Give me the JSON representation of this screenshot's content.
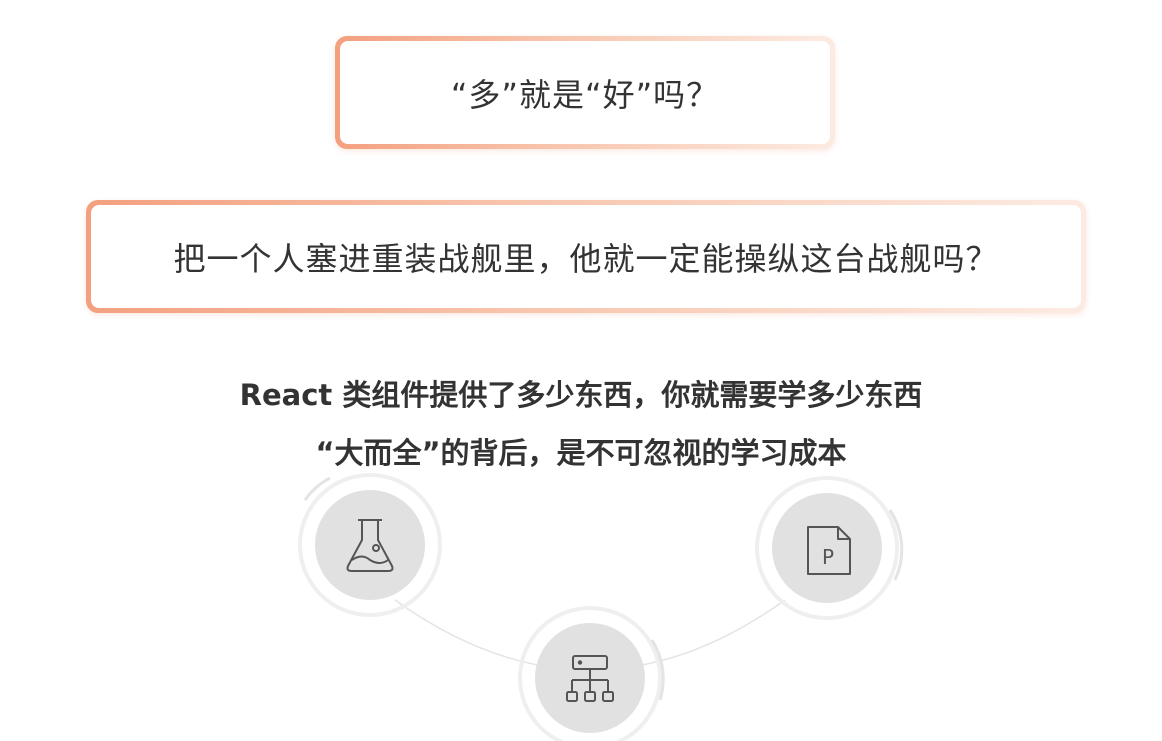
{
  "cards": {
    "question_1": "“多”就是“好”吗？",
    "question_2": "把一个人塞进重装战舰里，他就一定能操纵这台战舰吗？"
  },
  "statements": {
    "line_1": "React 类组件提供了多少东西，你就需要学多少东西",
    "line_2": "“大而全”的背后，是不可忽视的学习成本"
  },
  "diagram": {
    "nodes": [
      {
        "icon": "flask-icon"
      },
      {
        "icon": "file-p-icon",
        "letter": "P"
      },
      {
        "icon": "hierarchy-icon"
      }
    ]
  },
  "bottom_text": "",
  "colors": {
    "accent_orange": "#f3a07f",
    "accent_light": "#fcebe2",
    "node_fill": "#e1e1e1",
    "ring": "#ebebeb",
    "text": "#333333"
  }
}
